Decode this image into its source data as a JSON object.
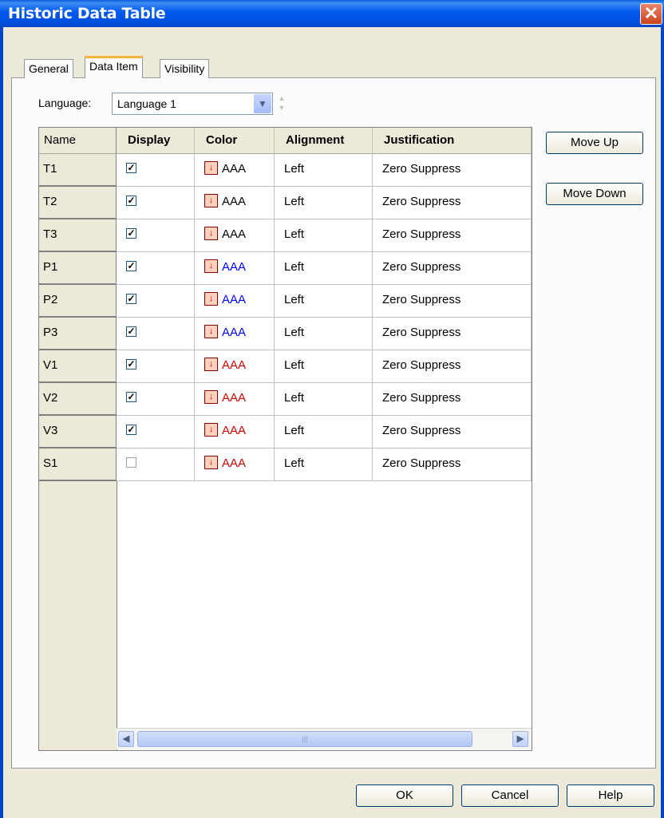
{
  "window": {
    "title": "Historic Data Table",
    "close_glyph": "✕"
  },
  "tabs": [
    {
      "label": "General",
      "active": false
    },
    {
      "label": "Data Item",
      "active": true
    },
    {
      "label": "Visibility",
      "active": false
    }
  ],
  "language": {
    "label": "Language:",
    "value": "Language 1"
  },
  "grid": {
    "headers": {
      "name": "Name",
      "display": "Display",
      "color": "Color",
      "alignment": "Alignment",
      "justification": "Justification"
    },
    "rows": [
      {
        "name": "T1",
        "display": true,
        "color_text": "AAA",
        "color_hex": "#000000",
        "alignment": "Left",
        "justification": "Zero Suppress"
      },
      {
        "name": "T2",
        "display": true,
        "color_text": "AAA",
        "color_hex": "#000000",
        "alignment": "Left",
        "justification": "Zero Suppress"
      },
      {
        "name": "T3",
        "display": true,
        "color_text": "AAA",
        "color_hex": "#000000",
        "alignment": "Left",
        "justification": "Zero Suppress"
      },
      {
        "name": "P1",
        "display": true,
        "color_text": "AAA",
        "color_hex": "#0000ff",
        "alignment": "Left",
        "justification": "Zero Suppress"
      },
      {
        "name": "P2",
        "display": true,
        "color_text": "AAA",
        "color_hex": "#0000ff",
        "alignment": "Left",
        "justification": "Zero Suppress"
      },
      {
        "name": "P3",
        "display": true,
        "color_text": "AAA",
        "color_hex": "#0000ff",
        "alignment": "Left",
        "justification": "Zero Suppress"
      },
      {
        "name": "V1",
        "display": true,
        "color_text": "AAA",
        "color_hex": "#cc0000",
        "alignment": "Left",
        "justification": "Zero Suppress"
      },
      {
        "name": "V2",
        "display": true,
        "color_text": "AAA",
        "color_hex": "#cc0000",
        "alignment": "Left",
        "justification": "Zero Suppress"
      },
      {
        "name": "V3",
        "display": true,
        "color_text": "AAA",
        "color_hex": "#cc0000",
        "alignment": "Left",
        "justification": "Zero Suppress"
      },
      {
        "name": "S1",
        "display": false,
        "color_text": "AAA",
        "color_hex": "#cc0000",
        "alignment": "Left",
        "justification": "Zero Suppress"
      }
    ]
  },
  "side_buttons": {
    "move_up": "Move Up",
    "move_down": "Move Down"
  },
  "footer_buttons": {
    "ok": "OK",
    "cancel": "Cancel",
    "help": "Help"
  },
  "icons": {
    "combo_arrow": "chevron-down-icon",
    "color_button": "color-picker-icon",
    "scroll_left": "arrow-left-icon",
    "scroll_right": "arrow-right-icon"
  }
}
